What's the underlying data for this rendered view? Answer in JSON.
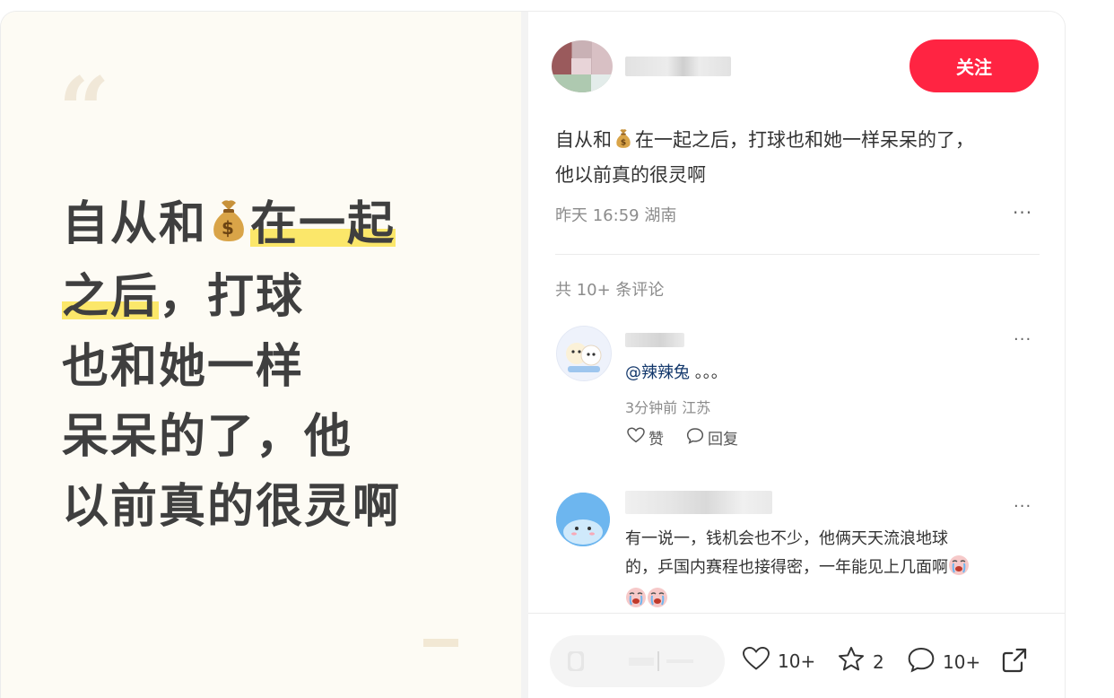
{
  "note_image": {
    "quote_mark": "“",
    "lines": [
      {
        "pre": "自从和",
        "emoji": "money-bag",
        "hl": "在一起",
        "post": ""
      },
      {
        "pre": "",
        "emoji": "",
        "hl": "之后",
        "post": "，打球"
      },
      {
        "pre": "也和她一样",
        "emoji": "",
        "hl": "",
        "post": ""
      },
      {
        "pre": "呆呆的了，他",
        "emoji": "",
        "hl": "",
        "post": ""
      },
      {
        "pre": "以前真的很灵啊",
        "emoji": "",
        "hl": "",
        "post": ""
      }
    ],
    "highlight_color": "#fbe76a"
  },
  "author": {
    "follow_label": "关注"
  },
  "post": {
    "text_before_emoji": "自从和",
    "emoji": "money-bag",
    "text_after_emoji": "在一起之后，打球也和她一样呆呆的了，",
    "text_line2": "他以前真的很灵啊",
    "time": "昨天 16:59",
    "location": "湖南",
    "more": "···"
  },
  "comments": {
    "count_label": "共 10+ 条评论",
    "items": [
      {
        "mention": "@辣辣兔",
        "text": " 。。。",
        "time": "3分钟前",
        "location": "江苏",
        "like_label": "赞",
        "reply_label": "回复",
        "more": "···"
      },
      {
        "text_line1": "有一说一，钱机会也不少，他俩天天流浪地球",
        "text_line2": "的，乒国内赛程也接得密，一年能见上几面啊",
        "emoji": "crying-face",
        "more": "···"
      }
    ]
  },
  "engagement": {
    "likes": "10+",
    "collects": "2",
    "comments": "10+"
  },
  "colors": {
    "accent": "#ff2442",
    "mention": "#13386c",
    "image_bg": "#fdfbf4"
  }
}
